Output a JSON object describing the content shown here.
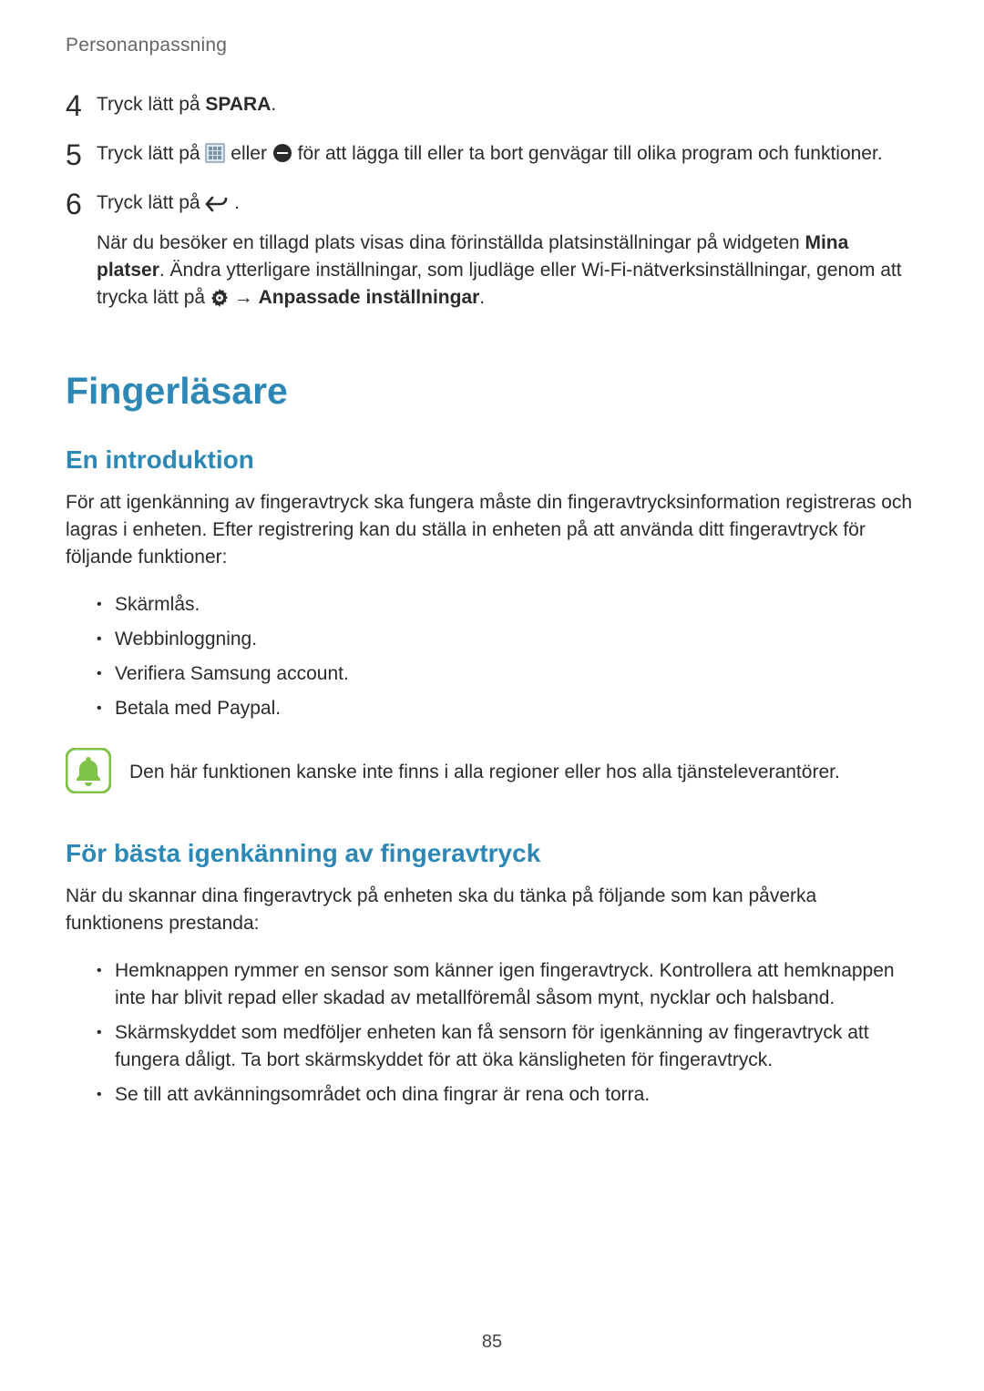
{
  "header": {
    "label": "Personanpassning"
  },
  "steps": {
    "s4": {
      "num": "4",
      "pre": "Tryck lätt på ",
      "bold": "SPARA",
      "post": "."
    },
    "s5": {
      "num": "5",
      "pre": "Tryck lätt på ",
      "mid": " eller ",
      "post": " för att lägga till eller ta bort genvägar till olika program och funktioner."
    },
    "s6": {
      "num": "6",
      "pre": "Tryck lätt på ",
      "post": ".",
      "sub_a": "När du besöker en tillagd plats visas dina förinställda platsinställningar på widgeten ",
      "sub_bold1": "Mina platser",
      "sub_b": ". Ändra ytterligare inställningar, som ljudläge eller Wi-Fi-nätverksinställningar, genom att trycka lätt på ",
      "arrow": " → ",
      "sub_bold2": "Anpassade inställningar",
      "sub_c": "."
    }
  },
  "h1": "Fingerläsare",
  "intro": {
    "title": "En introduktion",
    "text": "För att igenkänning av fingeravtryck ska fungera måste din fingeravtrycksinformation registreras och lagras i enheten. Efter registrering kan du ställa in enheten på att använda ditt fingeravtryck för följande funktioner:",
    "bullets": [
      "Skärmlås.",
      "Webbinloggning.",
      "Verifiera Samsung account.",
      "Betala med Paypal."
    ]
  },
  "note": {
    "text": "Den här funktionen kanske inte finns i alla regioner eller hos alla tjänsteleverantörer."
  },
  "best": {
    "title": "För bästa igenkänning av fingeravtryck",
    "text": "När du skannar dina fingeravtryck på enheten ska du tänka på följande som kan påverka funktionens prestanda:",
    "bullets": [
      "Hemknappen rymmer en sensor som känner igen fingeravtryck. Kontrollera att hemknappen inte har blivit repad eller skadad av metallföremål såsom mynt, nycklar och halsband.",
      "Skärmskyddet som medföljer enheten kan få sensorn för igenkänning av fingeravtryck att fungera dåligt. Ta bort skärmskyddet för att öka känsligheten för fingeravtryck.",
      "Se till att avkänningsområdet och dina fingrar är rena och torra."
    ]
  },
  "page_number": "85"
}
